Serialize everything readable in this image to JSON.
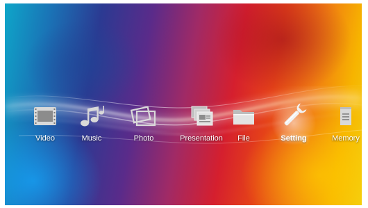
{
  "menu": {
    "selected": "Setting",
    "items": [
      {
        "label": "Video",
        "icon": "film-strip-icon"
      },
      {
        "label": "Music",
        "icon": "music-notes-icon"
      },
      {
        "label": "Photo",
        "icon": "photo-frames-icon"
      },
      {
        "label": "Presentation",
        "icon": "presentation-slides-icon"
      },
      {
        "label": "File",
        "icon": "folder-icon"
      },
      {
        "label": "Setting",
        "icon": "wrench-icon"
      },
      {
        "label": "Memory",
        "icon": "memory-card-icon"
      }
    ]
  },
  "colors": {
    "icon_fill": "#d9d9d9",
    "label": "#ffffff",
    "wallpaper_left": "#0ea6c9",
    "wallpaper_center": "#d51f2e",
    "wallpaper_right": "#f3cf10"
  }
}
